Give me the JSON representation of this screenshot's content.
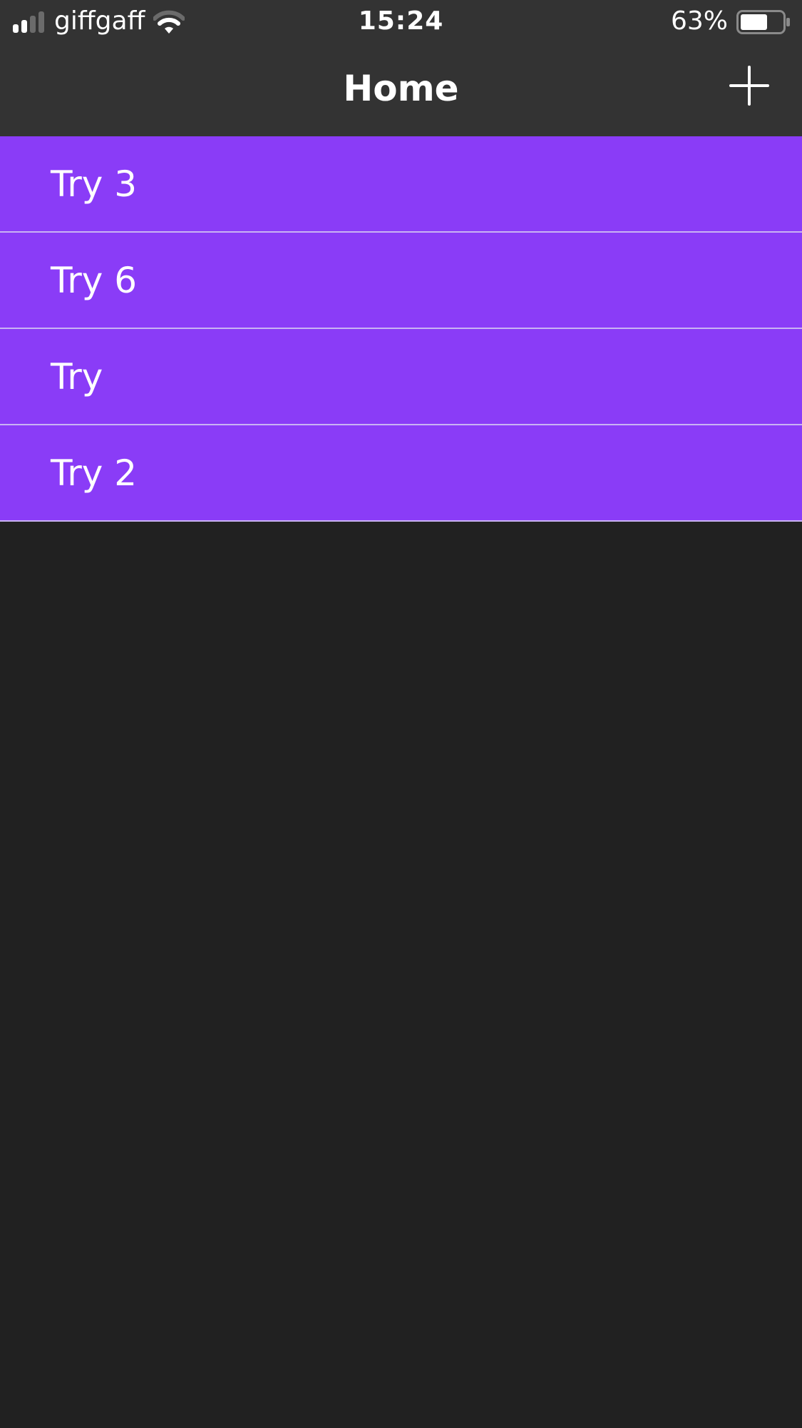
{
  "status_bar": {
    "carrier": "giffgaff",
    "time": "15:24",
    "battery_percent": "63%",
    "battery_level": 0.63,
    "signal_bars": 2,
    "signal_bars_total": 4,
    "icons": [
      "signal-icon",
      "wifi-icon",
      "battery-icon"
    ]
  },
  "nav": {
    "title": "Home",
    "add_icon": "plus-icon"
  },
  "list": {
    "items": [
      {
        "label": "Try 3"
      },
      {
        "label": "Try 6"
      },
      {
        "label": "Try"
      },
      {
        "label": "Try 2"
      }
    ]
  },
  "colors": {
    "background": "#212121",
    "header": "#333333",
    "row": "#8a3cf7",
    "separator": "#c9b3f3",
    "text": "#ffffff"
  }
}
